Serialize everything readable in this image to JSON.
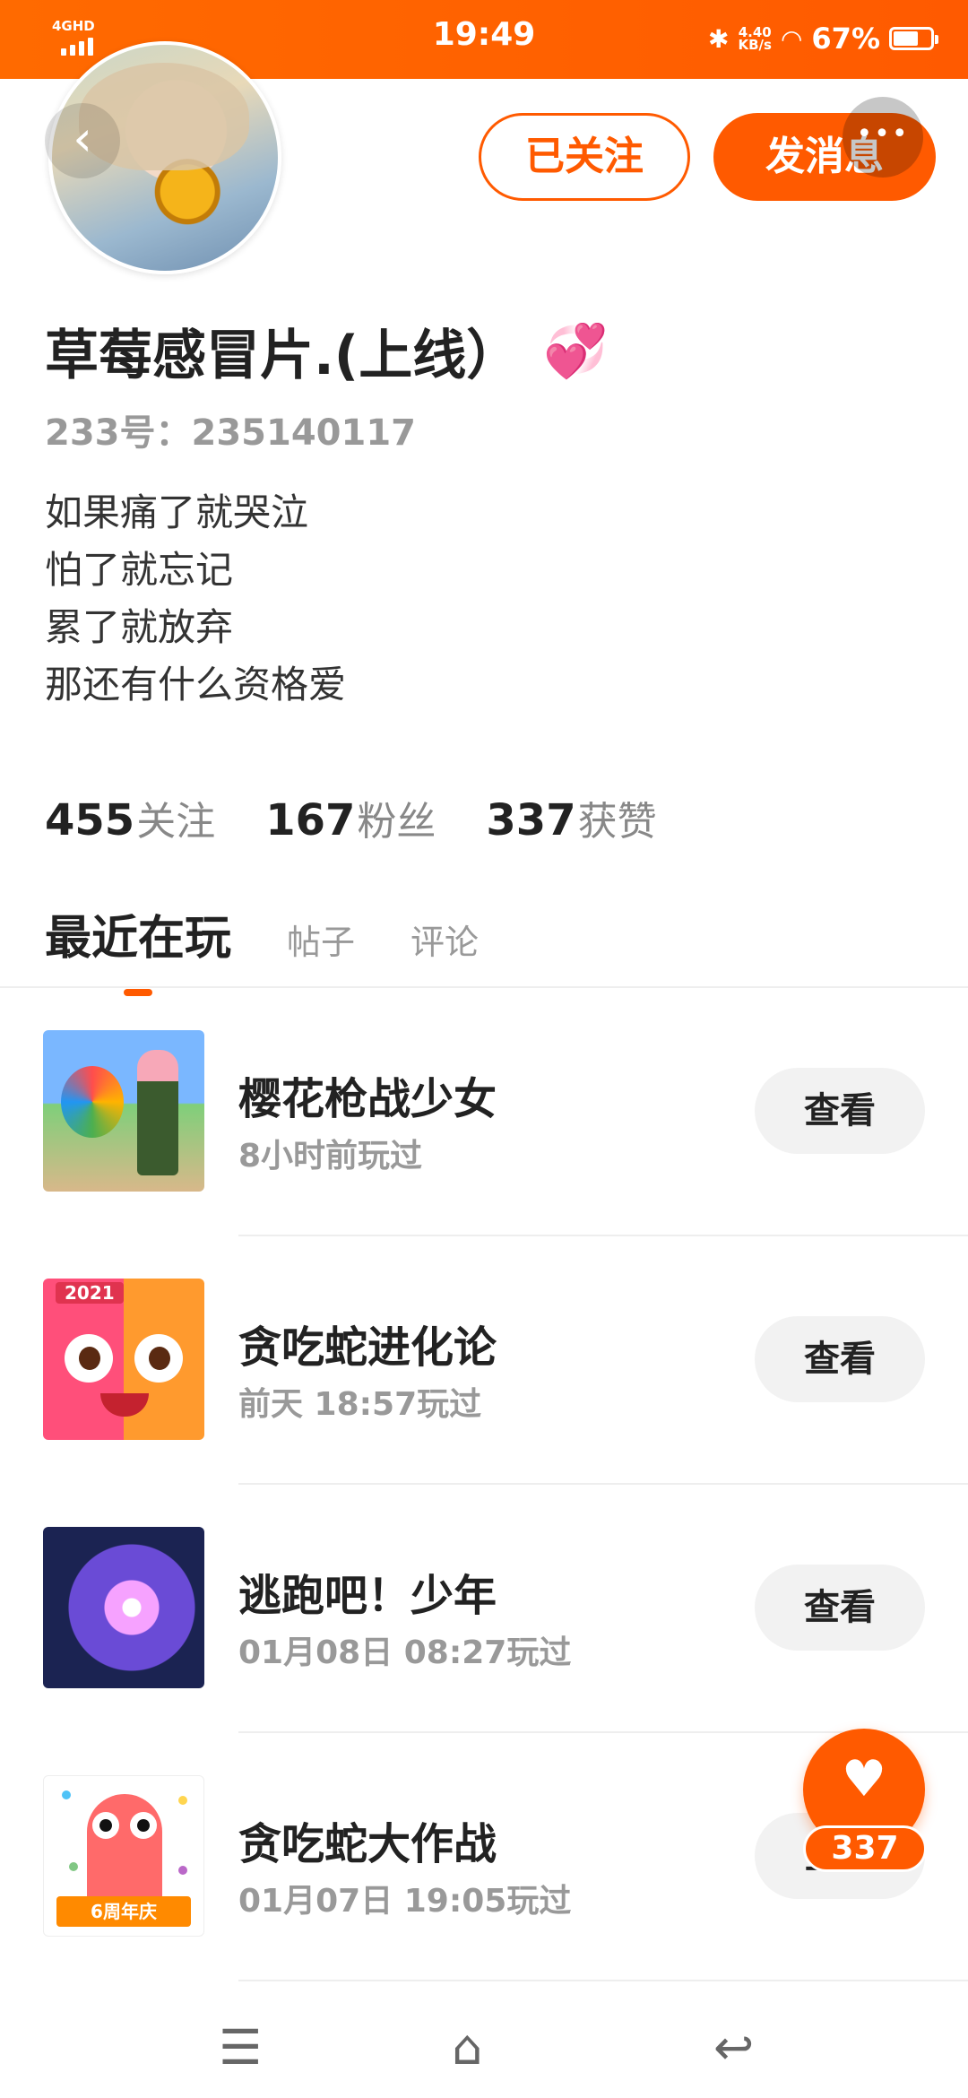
{
  "status_bar": {
    "network": "4GHD",
    "time": "19:49",
    "speed_value": "4.40",
    "speed_unit": "KB/s",
    "battery_percent": "67%",
    "battery_level": 0.67
  },
  "profile": {
    "name": "草莓感冒片.(上线）",
    "name_emoji": "💞",
    "uid": "233号：235140117",
    "bio": [
      "如果痛了就哭泣",
      "怕了就忘记",
      "累了就放弃",
      "那还有什么资格爱"
    ],
    "follow_label": "已关注",
    "message_label": "发消息"
  },
  "stats": [
    {
      "num": "455",
      "label": "关注"
    },
    {
      "num": "167",
      "label": "粉丝"
    },
    {
      "num": "337",
      "label": "获赞"
    }
  ],
  "tabs": [
    "最近在玩",
    "帖子",
    "评论"
  ],
  "games": [
    {
      "title": "樱花枪战少女",
      "time": "8小时前玩过",
      "button": "查看"
    },
    {
      "title": "贪吃蛇进化论",
      "time": "前天 18:57玩过",
      "button": "查看",
      "badge": "2021"
    },
    {
      "title": "逃跑吧！少年",
      "time": "01月08日 08:27玩过",
      "button": "查看"
    },
    {
      "title": "贪吃蛇大作战",
      "time": "01月07日 19:05玩过",
      "button": "查看",
      "banner": "6周年庆"
    }
  ],
  "like_fab": {
    "count": "337"
  },
  "icons": {
    "back": "chevron-left-icon",
    "more": "more-dots-icon",
    "heart": "heart-icon",
    "nav": [
      "menu-icon",
      "home-icon",
      "back-arrow-icon"
    ]
  },
  "colors": {
    "accent": "#ff5a00",
    "secondary_text": "#999999"
  }
}
